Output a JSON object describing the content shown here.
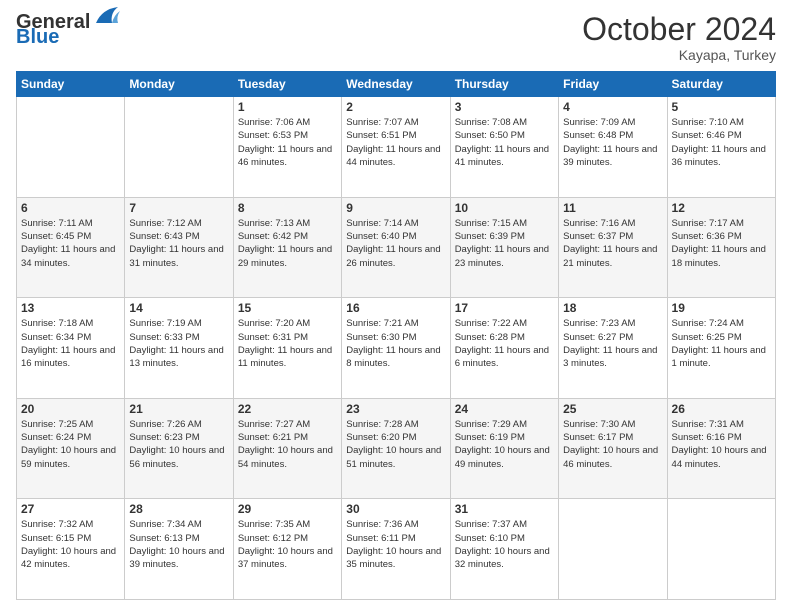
{
  "header": {
    "logo_line1": "General",
    "logo_line2": "Blue",
    "month": "October 2024",
    "location": "Kayapa, Turkey"
  },
  "weekdays": [
    "Sunday",
    "Monday",
    "Tuesday",
    "Wednesday",
    "Thursday",
    "Friday",
    "Saturday"
  ],
  "weeks": [
    [
      {
        "day": "",
        "sunrise": "",
        "sunset": "",
        "daylight": ""
      },
      {
        "day": "",
        "sunrise": "",
        "sunset": "",
        "daylight": ""
      },
      {
        "day": "1",
        "sunrise": "Sunrise: 7:06 AM",
        "sunset": "Sunset: 6:53 PM",
        "daylight": "Daylight: 11 hours and 46 minutes."
      },
      {
        "day": "2",
        "sunrise": "Sunrise: 7:07 AM",
        "sunset": "Sunset: 6:51 PM",
        "daylight": "Daylight: 11 hours and 44 minutes."
      },
      {
        "day": "3",
        "sunrise": "Sunrise: 7:08 AM",
        "sunset": "Sunset: 6:50 PM",
        "daylight": "Daylight: 11 hours and 41 minutes."
      },
      {
        "day": "4",
        "sunrise": "Sunrise: 7:09 AM",
        "sunset": "Sunset: 6:48 PM",
        "daylight": "Daylight: 11 hours and 39 minutes."
      },
      {
        "day": "5",
        "sunrise": "Sunrise: 7:10 AM",
        "sunset": "Sunset: 6:46 PM",
        "daylight": "Daylight: 11 hours and 36 minutes."
      }
    ],
    [
      {
        "day": "6",
        "sunrise": "Sunrise: 7:11 AM",
        "sunset": "Sunset: 6:45 PM",
        "daylight": "Daylight: 11 hours and 34 minutes."
      },
      {
        "day": "7",
        "sunrise": "Sunrise: 7:12 AM",
        "sunset": "Sunset: 6:43 PM",
        "daylight": "Daylight: 11 hours and 31 minutes."
      },
      {
        "day": "8",
        "sunrise": "Sunrise: 7:13 AM",
        "sunset": "Sunset: 6:42 PM",
        "daylight": "Daylight: 11 hours and 29 minutes."
      },
      {
        "day": "9",
        "sunrise": "Sunrise: 7:14 AM",
        "sunset": "Sunset: 6:40 PM",
        "daylight": "Daylight: 11 hours and 26 minutes."
      },
      {
        "day": "10",
        "sunrise": "Sunrise: 7:15 AM",
        "sunset": "Sunset: 6:39 PM",
        "daylight": "Daylight: 11 hours and 23 minutes."
      },
      {
        "day": "11",
        "sunrise": "Sunrise: 7:16 AM",
        "sunset": "Sunset: 6:37 PM",
        "daylight": "Daylight: 11 hours and 21 minutes."
      },
      {
        "day": "12",
        "sunrise": "Sunrise: 7:17 AM",
        "sunset": "Sunset: 6:36 PM",
        "daylight": "Daylight: 11 hours and 18 minutes."
      }
    ],
    [
      {
        "day": "13",
        "sunrise": "Sunrise: 7:18 AM",
        "sunset": "Sunset: 6:34 PM",
        "daylight": "Daylight: 11 hours and 16 minutes."
      },
      {
        "day": "14",
        "sunrise": "Sunrise: 7:19 AM",
        "sunset": "Sunset: 6:33 PM",
        "daylight": "Daylight: 11 hours and 13 minutes."
      },
      {
        "day": "15",
        "sunrise": "Sunrise: 7:20 AM",
        "sunset": "Sunset: 6:31 PM",
        "daylight": "Daylight: 11 hours and 11 minutes."
      },
      {
        "day": "16",
        "sunrise": "Sunrise: 7:21 AM",
        "sunset": "Sunset: 6:30 PM",
        "daylight": "Daylight: 11 hours and 8 minutes."
      },
      {
        "day": "17",
        "sunrise": "Sunrise: 7:22 AM",
        "sunset": "Sunset: 6:28 PM",
        "daylight": "Daylight: 11 hours and 6 minutes."
      },
      {
        "day": "18",
        "sunrise": "Sunrise: 7:23 AM",
        "sunset": "Sunset: 6:27 PM",
        "daylight": "Daylight: 11 hours and 3 minutes."
      },
      {
        "day": "19",
        "sunrise": "Sunrise: 7:24 AM",
        "sunset": "Sunset: 6:25 PM",
        "daylight": "Daylight: 11 hours and 1 minute."
      }
    ],
    [
      {
        "day": "20",
        "sunrise": "Sunrise: 7:25 AM",
        "sunset": "Sunset: 6:24 PM",
        "daylight": "Daylight: 10 hours and 59 minutes."
      },
      {
        "day": "21",
        "sunrise": "Sunrise: 7:26 AM",
        "sunset": "Sunset: 6:23 PM",
        "daylight": "Daylight: 10 hours and 56 minutes."
      },
      {
        "day": "22",
        "sunrise": "Sunrise: 7:27 AM",
        "sunset": "Sunset: 6:21 PM",
        "daylight": "Daylight: 10 hours and 54 minutes."
      },
      {
        "day": "23",
        "sunrise": "Sunrise: 7:28 AM",
        "sunset": "Sunset: 6:20 PM",
        "daylight": "Daylight: 10 hours and 51 minutes."
      },
      {
        "day": "24",
        "sunrise": "Sunrise: 7:29 AM",
        "sunset": "Sunset: 6:19 PM",
        "daylight": "Daylight: 10 hours and 49 minutes."
      },
      {
        "day": "25",
        "sunrise": "Sunrise: 7:30 AM",
        "sunset": "Sunset: 6:17 PM",
        "daylight": "Daylight: 10 hours and 46 minutes."
      },
      {
        "day": "26",
        "sunrise": "Sunrise: 7:31 AM",
        "sunset": "Sunset: 6:16 PM",
        "daylight": "Daylight: 10 hours and 44 minutes."
      }
    ],
    [
      {
        "day": "27",
        "sunrise": "Sunrise: 7:32 AM",
        "sunset": "Sunset: 6:15 PM",
        "daylight": "Daylight: 10 hours and 42 minutes."
      },
      {
        "day": "28",
        "sunrise": "Sunrise: 7:34 AM",
        "sunset": "Sunset: 6:13 PM",
        "daylight": "Daylight: 10 hours and 39 minutes."
      },
      {
        "day": "29",
        "sunrise": "Sunrise: 7:35 AM",
        "sunset": "Sunset: 6:12 PM",
        "daylight": "Daylight: 10 hours and 37 minutes."
      },
      {
        "day": "30",
        "sunrise": "Sunrise: 7:36 AM",
        "sunset": "Sunset: 6:11 PM",
        "daylight": "Daylight: 10 hours and 35 minutes."
      },
      {
        "day": "31",
        "sunrise": "Sunrise: 7:37 AM",
        "sunset": "Sunset: 6:10 PM",
        "daylight": "Daylight: 10 hours and 32 minutes."
      },
      {
        "day": "",
        "sunrise": "",
        "sunset": "",
        "daylight": ""
      },
      {
        "day": "",
        "sunrise": "",
        "sunset": "",
        "daylight": ""
      }
    ]
  ]
}
